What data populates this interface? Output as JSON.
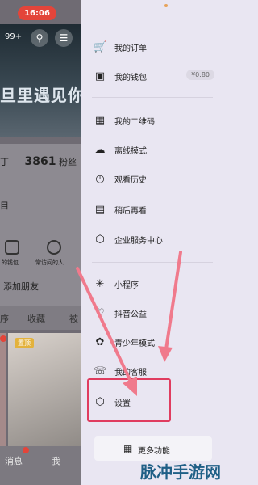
{
  "status": {
    "time": "16:06"
  },
  "background_page": {
    "badge_count": "99+",
    "banner_text": "旦里遇见你",
    "fans_count": "3861",
    "fans_label": "粉丝",
    "partial_label": "目",
    "quick_labels": [
      "的钱包",
      "常访问的人"
    ],
    "add_friend": "添加朋友",
    "tabs": [
      "序",
      "收藏",
      "被"
    ],
    "thumb_tag": "置顶",
    "bottom_nav": [
      "消息",
      "我"
    ]
  },
  "drawer": {
    "items": [
      {
        "icon": "cart-icon",
        "label": "我的订单"
      },
      {
        "icon": "wallet-icon",
        "label": "我的钱包",
        "amount": "¥0.80"
      },
      {
        "icon": "qr-code-icon",
        "label": "我的二维码"
      },
      {
        "icon": "offline-icon",
        "label": "离线模式"
      },
      {
        "icon": "history-icon",
        "label": "观看历史"
      },
      {
        "icon": "watch-later-icon",
        "label": "稍后再看"
      },
      {
        "icon": "enterprise-icon",
        "label": "企业服务中心"
      },
      {
        "icon": "mini-program-icon",
        "label": "小程序"
      },
      {
        "icon": "charity-icon",
        "label": "抖音公益"
      },
      {
        "icon": "youth-mode-icon",
        "label": "青少年模式"
      },
      {
        "icon": "customer-service-icon",
        "label": "我的客服"
      },
      {
        "icon": "settings-icon",
        "label": "设置"
      }
    ],
    "more_button": "更多功能"
  },
  "watermark": "脉冲手游网",
  "colors": {
    "highlight": "#e03c5f",
    "arrow": "#f07a8c",
    "drawer_bg": "#e9e6f2",
    "time_pill": "#e3453a"
  }
}
